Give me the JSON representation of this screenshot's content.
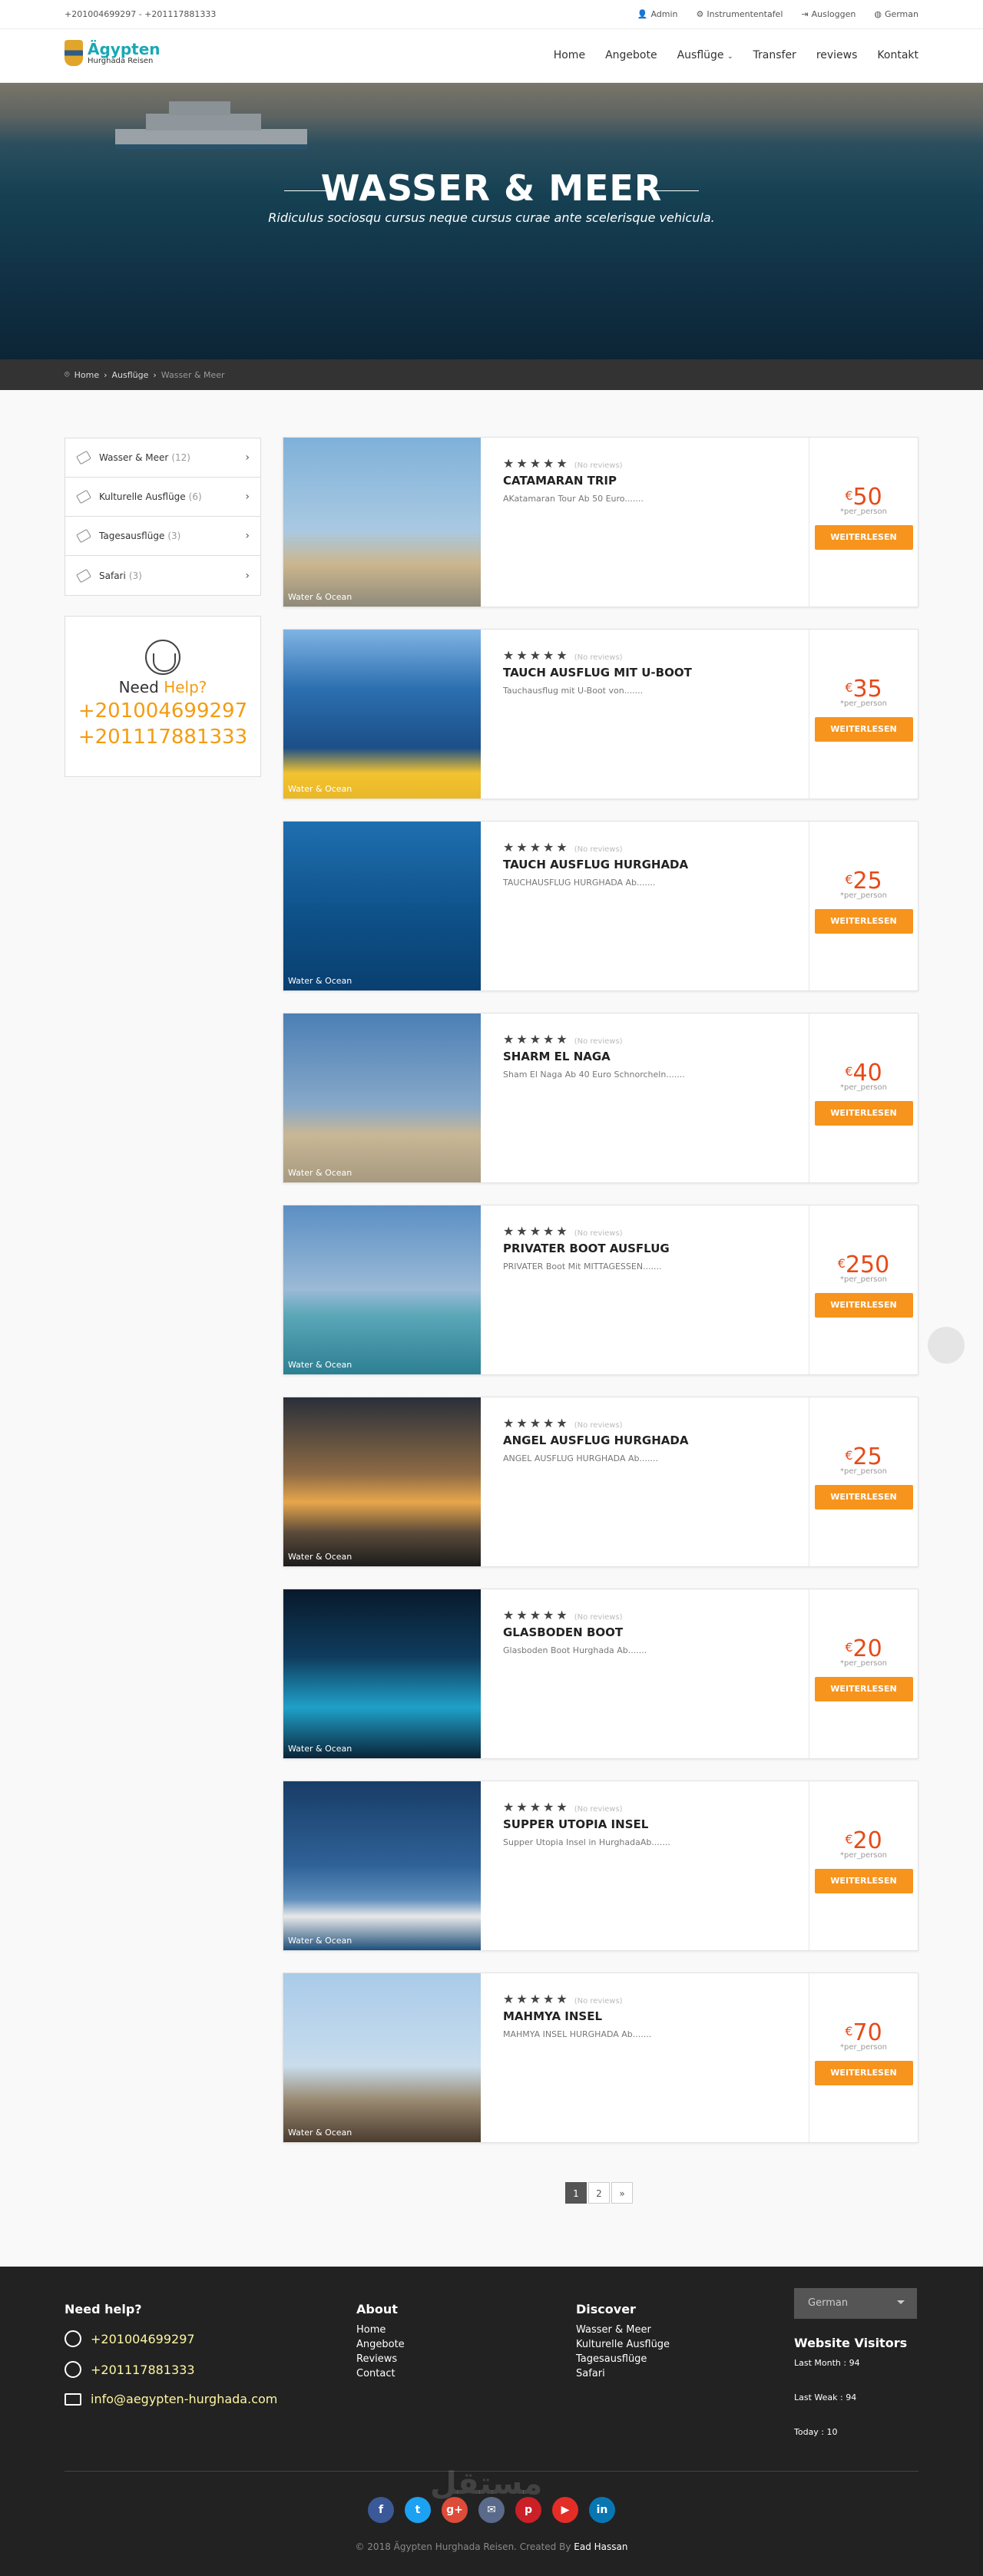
{
  "topbar": {
    "phones": "+201004699297 - +201117881333",
    "links": [
      "Admin",
      "Instrumententafel",
      "Ausloggen",
      "German"
    ]
  },
  "logo": {
    "name": "Ägypten",
    "sub": "Hurghada Reisen"
  },
  "nav": [
    "Home",
    "Angebote",
    "Ausflüge",
    "Transfer",
    "reviews",
    "Kontakt"
  ],
  "hero": {
    "title": "WASSER & MEER",
    "subtitle": "Ridiculus sociosqu cursus neque cursus curae ante scelerisque vehicula."
  },
  "breadcrumb": [
    "Home",
    "Ausflüge",
    "Wasser & Meer"
  ],
  "categories": [
    {
      "label": "Wasser & Meer",
      "count": "(12)"
    },
    {
      "label": "Kulturelle Ausflüge",
      "count": "(6)"
    },
    {
      "label": "Tagesausflüge",
      "count": "(3)"
    },
    {
      "label": "Safari",
      "count": "(3)"
    }
  ],
  "help": {
    "need": "Need",
    "help": "Help?",
    "phone1": "+201004699297",
    "phone2": "+201117881333"
  },
  "tour_common": {
    "image_label": "Water & Ocean",
    "reviews": "(No reviews)",
    "per": "*per_person",
    "button": "WEITERLESEN",
    "currency": "€"
  },
  "tours": [
    {
      "title": "CATAMARAN TRIP",
      "desc": "AKatamaran Tour Ab 50 Euro.......",
      "price": "50"
    },
    {
      "title": "TAUCH AUSFLUG MIT U-BOOT",
      "desc": "Tauchausflug mit U-Boot von.......",
      "price": "35"
    },
    {
      "title": "TAUCH AUSFLUG HURGHADA",
      "desc": "TAUCHAUSFLUG HURGHADA Ab.......",
      "price": "25"
    },
    {
      "title": "SHARM EL NAGA",
      "desc": "Sham El Naga Ab 40 Euro Schnorcheln.......",
      "price": "40"
    },
    {
      "title": "PRIVATER BOOT AUSFLUG",
      "desc": "PRIVATER Boot Mit MITTAGESSEN.......",
      "price": "250"
    },
    {
      "title": "ANGEL AUSFLUG HURGHADA",
      "desc": "ANGEL AUSFLUG HURGHADA Ab.......",
      "price": "25"
    },
    {
      "title": "GLASBODEN BOOT",
      "desc": "Glasboden Boot Hurghada Ab.......",
      "price": "20"
    },
    {
      "title": "SUPPER UTOPIA INSEL",
      "desc": "Supper Utopia Insel in HurghadaAb.......",
      "price": "20"
    },
    {
      "title": "MAHMYA INSEL",
      "desc": "MAHMYA INSEL HURGHADA Ab.......",
      "price": "70"
    }
  ],
  "pagination": [
    "1",
    "2",
    "»"
  ],
  "footer": {
    "help_title": "Need help?",
    "phone1": "+201004699297",
    "phone2": "+201117881333",
    "email": "info@aegypten-hurghada.com",
    "about_title": "About",
    "about_links": [
      "Home",
      "Angebote",
      "Reviews",
      "Contact"
    ],
    "discover_title": "Discover",
    "discover_links": [
      "Wasser & Meer",
      "Kulturelle Ausflüge",
      "Tagesausflüge",
      "Safari"
    ],
    "language": "German",
    "visitors_title": "Website Visitors",
    "visitors": [
      "Last Month : 94",
      "Last Weak : 94",
      "Today : 10"
    ],
    "copyright": "© 2018 Ägypten Hurghada Reisen. Created By",
    "author": "Ead Hassan",
    "social": [
      {
        "name": "facebook",
        "glyph": "f",
        "color": "#3b5998"
      },
      {
        "name": "twitter",
        "glyph": "t",
        "color": "#1da1f2"
      },
      {
        "name": "google-plus",
        "glyph": "g+",
        "color": "#dd4b39"
      },
      {
        "name": "email",
        "glyph": "✉",
        "color": "#5a6a8a"
      },
      {
        "name": "pinterest",
        "glyph": "p",
        "color": "#cb2027"
      },
      {
        "name": "youtube",
        "glyph": "▶",
        "color": "#e52d27"
      },
      {
        "name": "linkedin",
        "glyph": "in",
        "color": "#0976b4"
      }
    ]
  },
  "watermark": "مستقل"
}
